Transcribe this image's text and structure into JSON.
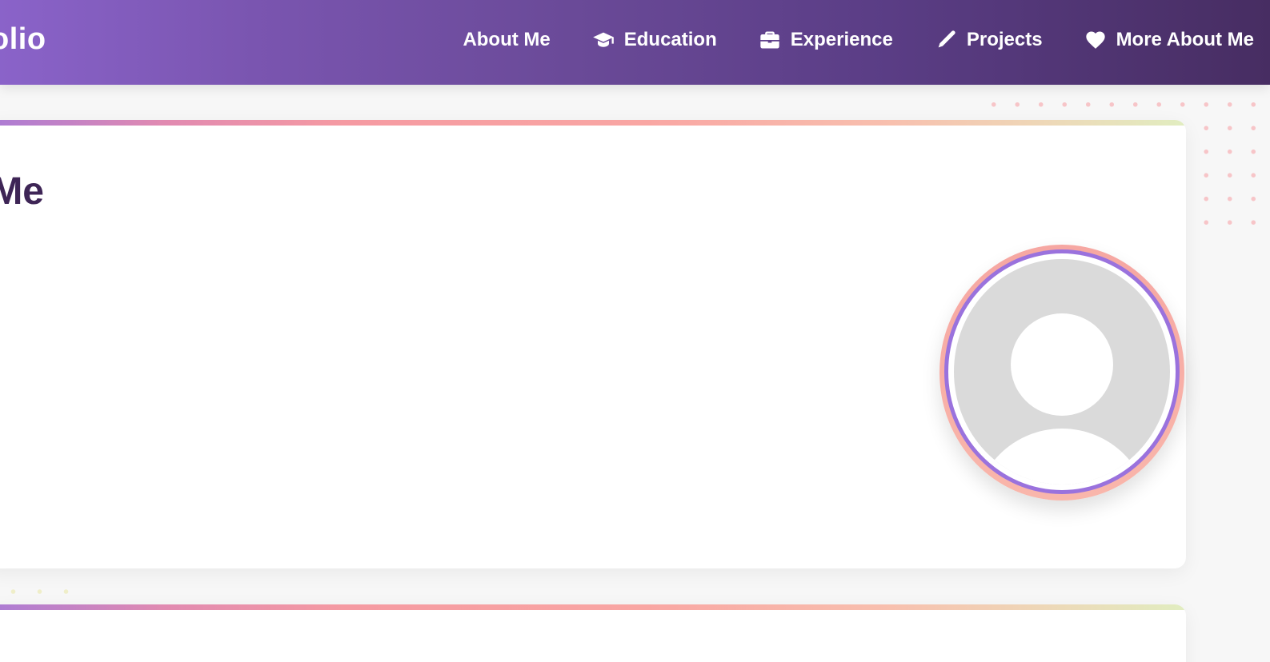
{
  "header": {
    "brand": "olio",
    "nav": [
      {
        "label": "About Me",
        "icon": ""
      },
      {
        "label": "Education",
        "icon": "graduation-cap-icon"
      },
      {
        "label": "Experience",
        "icon": "briefcase-icon"
      },
      {
        "label": "Projects",
        "icon": "pencil-icon"
      },
      {
        "label": "More About Me",
        "icon": "heart-icon"
      }
    ]
  },
  "about": {
    "title": "t Me",
    "avatar": "profile-placeholder"
  },
  "colors": {
    "header_gradient_start": "#8a63c9",
    "header_gradient_end": "#472d62",
    "title_color": "#3e2556",
    "avatar_ring": "#9a72dd",
    "avatar_outer": "#f6a7a2"
  }
}
